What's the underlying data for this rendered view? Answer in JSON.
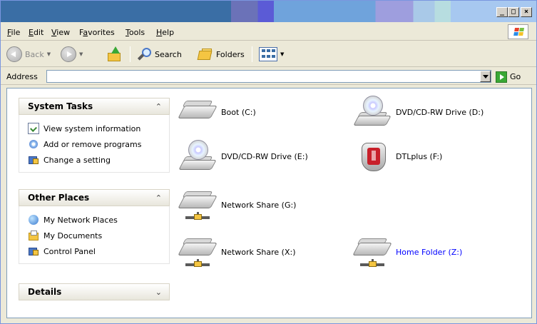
{
  "menu": {
    "items": [
      {
        "label": "File",
        "key": "F",
        "rest": "ile"
      },
      {
        "label": "Edit",
        "key": "E",
        "rest": "dit"
      },
      {
        "label": "View",
        "key": "V",
        "rest": "iew"
      },
      {
        "label": "Favorites",
        "key": "a",
        "pre": "F",
        "rest": "vorites"
      },
      {
        "label": "Tools",
        "key": "T",
        "rest": "ools"
      },
      {
        "label": "Help",
        "key": "H",
        "rest": "elp"
      }
    ]
  },
  "toolbar": {
    "back_label": "Back",
    "search_label": "Search",
    "folders_label": "Folders"
  },
  "address": {
    "label": "Address",
    "value": "",
    "go_label": "Go"
  },
  "panels": {
    "system_tasks": {
      "title": "System Tasks",
      "items": [
        "View system information",
        "Add or remove programs",
        "Change a setting"
      ]
    },
    "other_places": {
      "title": "Other Places",
      "items": [
        "My Network Places",
        "My Documents",
        "Control Panel"
      ]
    },
    "details": {
      "title": "Details"
    }
  },
  "drives": [
    {
      "label": "Boot (C:)",
      "type": "hdd"
    },
    {
      "label": "DVD/CD-RW Drive (D:)",
      "type": "cd"
    },
    {
      "label": "DVD/CD-RW Drive (E:)",
      "type": "cd"
    },
    {
      "label": "DTLplus (F:)",
      "type": "usb"
    },
    {
      "label": "Network Share (G:)",
      "type": "network"
    },
    {
      "label": "Network Share (X:)",
      "type": "network"
    },
    {
      "label": "Home Folder (Z:)",
      "type": "network",
      "color": "#0000ff"
    }
  ],
  "colors": {
    "accent": "#3a6ea5",
    "link": "#0000ff"
  }
}
